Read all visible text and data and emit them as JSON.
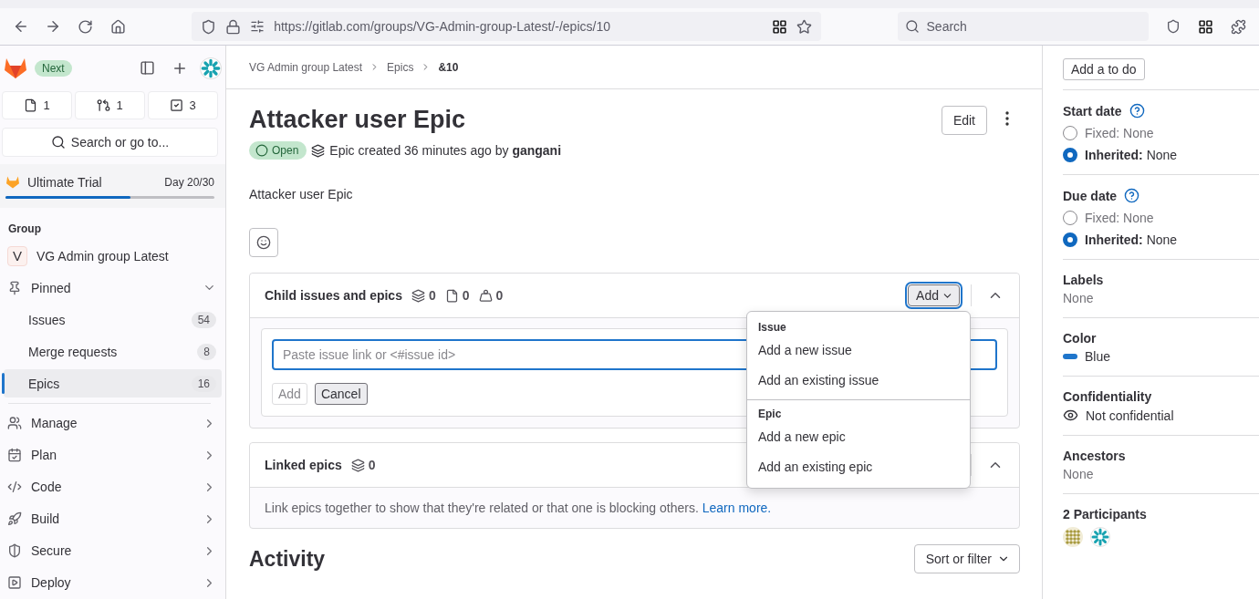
{
  "browser": {
    "url": "https://gitlab.com/groups/VG-Admin-group-Latest/-/epics/10",
    "search_placeholder": "Search"
  },
  "sidebar": {
    "badge": "Next",
    "counters": [
      {
        "kind": "issues",
        "count": "1"
      },
      {
        "kind": "merge",
        "count": "1"
      },
      {
        "kind": "todo",
        "count": "3"
      }
    ],
    "search": "Search or go to...",
    "trial": {
      "label": "Ultimate Trial",
      "day": "Day 20/30",
      "level": 0.6
    },
    "section": "Group",
    "group": {
      "initial": "V",
      "name": "VG Admin group Latest"
    },
    "pinned": {
      "label": "Pinned",
      "expanded": true,
      "items": [
        {
          "label": "Issues",
          "count": "54",
          "selected": false
        },
        {
          "label": "Merge requests",
          "count": "8",
          "selected": false
        },
        {
          "label": "Epics",
          "count": "16",
          "selected": true
        }
      ]
    },
    "menu": [
      {
        "kind": "manage",
        "label": "Manage"
      },
      {
        "kind": "plan",
        "label": "Plan"
      },
      {
        "kind": "code",
        "label": "Code"
      },
      {
        "kind": "build",
        "label": "Build"
      },
      {
        "kind": "secure",
        "label": "Secure"
      },
      {
        "kind": "deploy",
        "label": "Deploy"
      }
    ]
  },
  "breadcrumbs": [
    "VG Admin group Latest",
    "Epics",
    "&10"
  ],
  "epic": {
    "title": "Attacker user Epic",
    "status": "Open",
    "meta": "Epic created 36 minutes ago by",
    "author": "gangani",
    "description": "Attacker user Epic",
    "edit": "Edit"
  },
  "child_card": {
    "title": "Child issues and epics",
    "counts": [
      {
        "kind": "epic",
        "count": "0"
      },
      {
        "kind": "issue",
        "count": "0"
      },
      {
        "kind": "weight",
        "count": "0"
      }
    ],
    "add_button": "Add",
    "input_placeholder": "Paste issue link or <#issue id>",
    "submit": "Add",
    "cancel": "Cancel"
  },
  "add_menu": [
    {
      "heading": "Issue",
      "items": [
        "Add a new issue",
        "Add an existing issue"
      ]
    },
    {
      "heading": "Epic",
      "items": [
        "Add a new epic",
        "Add an existing epic"
      ]
    }
  ],
  "linked_card": {
    "title": "Linked epics",
    "count": "0",
    "text": "Link epics together to show that they're related or that one is blocking others.",
    "link": "Learn more."
  },
  "activity": {
    "title": "Activity",
    "sort": "Sort or filter"
  },
  "right": {
    "todo": "Add a to do",
    "dates": [
      {
        "title": "Start date",
        "options": [
          {
            "label": "Fixed:",
            "value": "None",
            "selected": false
          },
          {
            "label": "Inherited:",
            "value": "None",
            "selected": true
          }
        ]
      },
      {
        "title": "Due date",
        "options": [
          {
            "label": "Fixed:",
            "value": "None",
            "selected": false
          },
          {
            "label": "Inherited:",
            "value": "None",
            "selected": true
          }
        ]
      }
    ],
    "labels": {
      "title": "Labels",
      "value": "None"
    },
    "color": {
      "title": "Color",
      "name": "Blue",
      "color": "#1f75cb"
    },
    "confidentiality": {
      "title": "Confidentiality",
      "value": "Not confidential"
    },
    "ancestors": {
      "title": "Ancestors",
      "value": "None"
    },
    "participants": {
      "title": "2 Participants"
    }
  }
}
